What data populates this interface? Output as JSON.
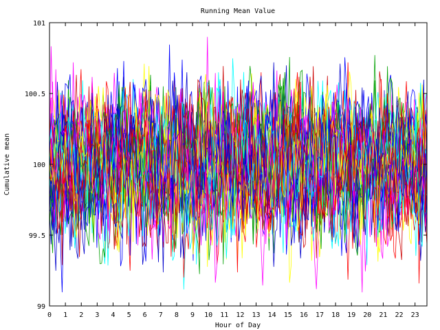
{
  "chart_data": {
    "type": "line",
    "title": "Running Mean Value",
    "xlabel": "Hour of Day",
    "ylabel": "Cumulative mean",
    "xlim": [
      0,
      23.75
    ],
    "ylim": [
      99,
      101
    ],
    "x_ticks": [
      0,
      1,
      2,
      3,
      4,
      5,
      6,
      7,
      8,
      9,
      10,
      11,
      12,
      13,
      14,
      15,
      16,
      17,
      18,
      19,
      20,
      21,
      22,
      23
    ],
    "y_ticks": [
      99,
      99.5,
      100,
      100.5,
      101
    ],
    "y_tick_labels": [
      "99",
      "99.5",
      "100",
      "100.5",
      "101"
    ],
    "grid": false,
    "legend": "none",
    "series_count": 40,
    "points_per_series": 240,
    "series_colors": [
      "#ff0000",
      "#00a000",
      "#0000ff",
      "#ff00ff",
      "#00ffff",
      "#ffff00",
      "#0000cc",
      "#cc0000"
    ],
    "center_value": 100,
    "typical_range": [
      99.5,
      100.5
    ],
    "observed_min": 99.0,
    "observed_max": 100.9
  }
}
